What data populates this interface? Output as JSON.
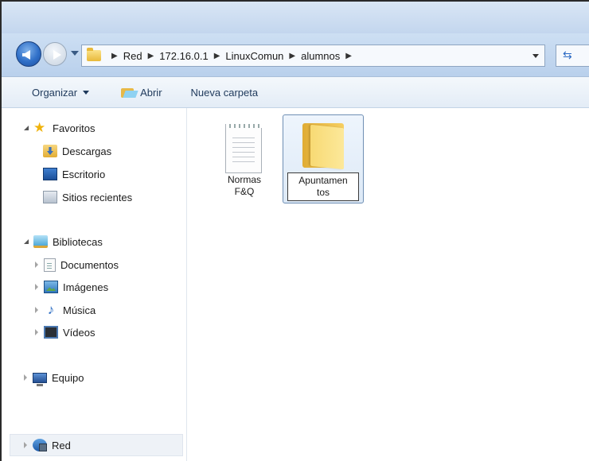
{
  "address": {
    "crumbs": [
      "Red",
      "172.16.0.1",
      "LinuxComun",
      "alumnos"
    ]
  },
  "toolbar": {
    "organize": "Organizar",
    "open": "Abrir",
    "new_folder": "Nueva carpeta"
  },
  "sidebar": {
    "favorites": "Favoritos",
    "fav_items": [
      "Descargas",
      "Escritorio",
      "Sitios recientes"
    ],
    "libraries": "Bibliotecas",
    "lib_items": [
      "Documentos",
      "Imágenes",
      "Música",
      "Vídeos"
    ],
    "computer": "Equipo",
    "network": "Red"
  },
  "files": [
    {
      "name_line1": "Normas",
      "name_line2": "F&Q",
      "icon": "text-document-icon"
    },
    {
      "name_line1": "Apuntamen",
      "name_line2": "tos",
      "icon": "folder-icon",
      "selected": true
    }
  ]
}
